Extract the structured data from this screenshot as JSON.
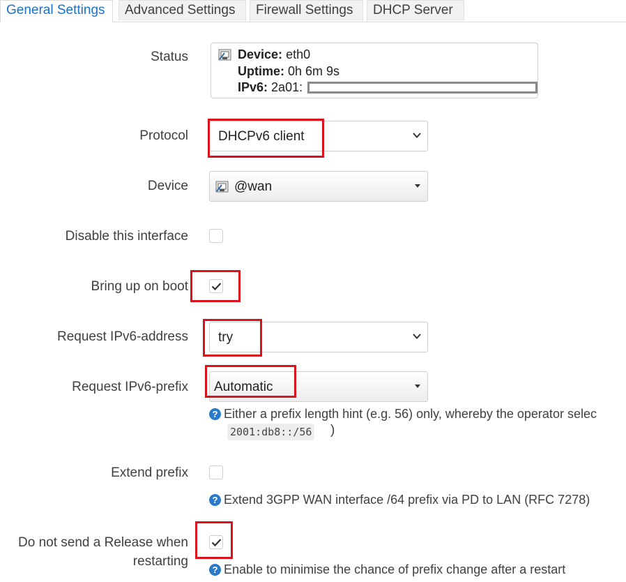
{
  "tabs": [
    "General Settings",
    "Advanced Settings",
    "Firewall Settings",
    "DHCP Server"
  ],
  "status": {
    "label": "Status",
    "device_key": "Device:",
    "device_val": "eth0",
    "uptime_key": "Uptime:",
    "uptime_val": "0h 6m 9s",
    "ipv6_key": "IPv6:",
    "ipv6_val": "2a01:"
  },
  "protocol": {
    "label": "Protocol",
    "value": "DHCPv6 client"
  },
  "device": {
    "label": "Device",
    "value": "@wan"
  },
  "disable_interface": {
    "label": "Disable this interface",
    "checked": false
  },
  "bring_up_on_boot": {
    "label": "Bring up on boot",
    "checked": true
  },
  "request_address": {
    "label": "Request IPv6-address",
    "value": "try"
  },
  "request_prefix": {
    "label": "Request IPv6-prefix",
    "value": "Automatic",
    "help": "Either a prefix length hint (e.g. 56) only, whereby the operator selec",
    "code": "2001:db8::/56",
    "paren": ")"
  },
  "extend_prefix": {
    "label": "Extend prefix",
    "checked": false,
    "help": "Extend 3GPP WAN interface /64 prefix via PD to LAN (RFC 7278)"
  },
  "no_release": {
    "label_line1": "Do not send a Release when",
    "label_line2": "restarting",
    "checked": true,
    "help": "Enable to minimise the chance of prefix change after a restart"
  },
  "colors": {
    "accent": "#1a73c8",
    "highlight": "#d9121b",
    "help_icon": "#2a7ac9"
  },
  "icons": {
    "help": "?"
  }
}
